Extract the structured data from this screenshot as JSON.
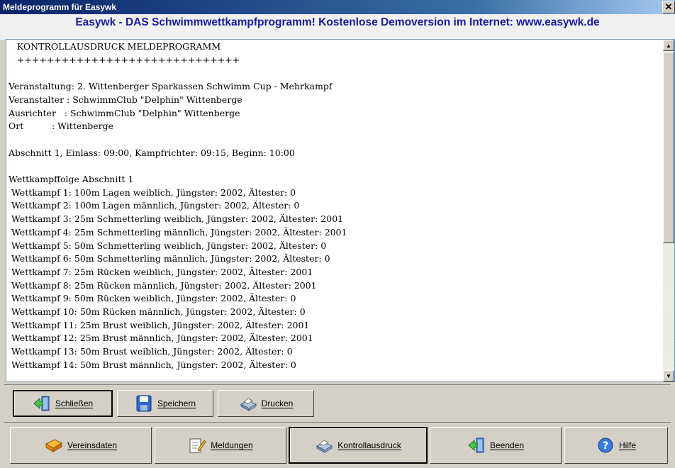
{
  "window": {
    "title": "Meldeprogramm für Easywk",
    "close_glyph": "✕"
  },
  "banner": {
    "text": "Easywk - DAS Schwimmwettkampfprogramm! Kostenlose Demoversion im Internet: www.easywk.de"
  },
  "report": {
    "lines": [
      "   KONTROLLAUSDRUCK MELDEPROGRAMM",
      "   ++++++++++++++++++++++++++++++",
      "",
      "Veranstaltung: 2. Wittenberger Sparkassen Schwimm Cup - Mehrkampf",
      "Veranstalter : SchwimmClub \"Delphin\" Wittenberge",
      "Ausrichter   : SchwimmClub \"Delphin\" Wittenberge",
      "Ort          : Wittenberge",
      "",
      "Abschnitt 1, Einlass: 09:00, Kampfrichter: 09:15, Beginn: 10:00",
      "",
      "Wettkampffolge Abschnitt 1",
      " Wettkampf 1: 100m Lagen weiblich, Jüngster: 2002, Ältester: 0",
      " Wettkampf 2: 100m Lagen männlich, Jüngster: 2002, Ältester: 0",
      " Wettkampf 3: 25m Schmetterling weiblich, Jüngster: 2002, Ältester: 2001",
      " Wettkampf 4: 25m Schmetterling männlich, Jüngster: 2002, Ältester: 2001",
      " Wettkampf 5: 50m Schmetterling weiblich, Jüngster: 2002, Ältester: 0",
      " Wettkampf 6: 50m Schmetterling männlich, Jüngster: 2002, Ältester: 0",
      " Wettkampf 7: 25m Rücken weiblich, Jüngster: 2002, Ältester: 2001",
      " Wettkampf 8: 25m Rücken männlich, Jüngster: 2002, Ältester: 2001",
      " Wettkampf 9: 50m Rücken weiblich, Jüngster: 2002, Ältester: 0",
      " Wettkampf 10: 50m Rücken männlich, Jüngster: 2002, Ältester: 0",
      " Wettkampf 11: 25m Brust weiblich, Jüngster: 2002, Ältester: 2001",
      " Wettkampf 12: 25m Brust männlich, Jüngster: 2002, Ältester: 2001",
      " Wettkampf 13: 50m Brust weiblich, Jüngster: 2002, Ältester: 0",
      " Wettkampf 14: 50m Brust männlich, Jüngster: 2002, Ältester: 0"
    ]
  },
  "toolbar1": {
    "close_label": "Schließen",
    "save_label": "Speichern",
    "print_label": "Drucken"
  },
  "toolbar2": {
    "club_label": "Vereinsdaten",
    "entries_label": "Meldungen",
    "control_label": "Kontrollausdruck",
    "exit_label": "Beenden",
    "help_label": "Hilfe"
  },
  "colors": {
    "banner_text": "#1a1aa6",
    "title_bar": "#0a246a",
    "face": "#d4d0c8"
  }
}
